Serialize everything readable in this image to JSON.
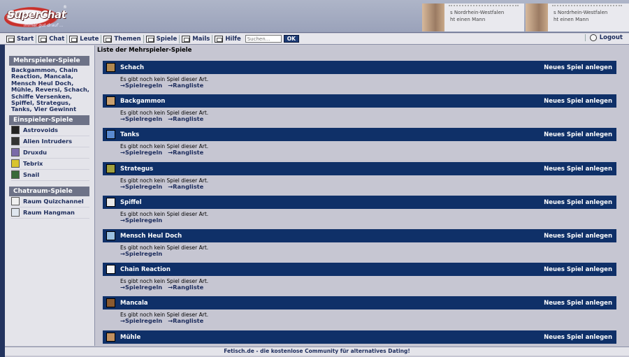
{
  "logo": {
    "name": "SuperChat",
    "tagline": "immer gut drauf ...",
    "reg": "®"
  },
  "ads": [
    {
      "line1": "s Nordrhein-Westfalen",
      "line2": "ht einen Mann"
    },
    {
      "line1": "s Nordrhein-Westfalen",
      "line2": "ht einen Mann"
    }
  ],
  "nav": {
    "items": [
      {
        "label": "Start",
        "icon": "home-icon"
      },
      {
        "label": "Chat",
        "icon": "chat-icon"
      },
      {
        "label": "Leute",
        "icon": "people-icon"
      },
      {
        "label": "Themen",
        "icon": "topics-icon"
      },
      {
        "label": "Spiele",
        "icon": "games-icon"
      },
      {
        "label": "Mails",
        "icon": "mail-icon"
      },
      {
        "label": "Hilfe",
        "icon": "help-icon"
      }
    ],
    "search_placeholder": "Suchen...",
    "ok_label": "OK",
    "logout_label": "Logout"
  },
  "sidebar": {
    "multi_title": "Mehrspieler-Spiele",
    "multi_list": "Backgammon, Chain Reaction, Mancala, Mensch Heul Doch, Mühle, Reversi, Schach, Schiffe Versenken, Spiffel, Strategus, Tanks, Vier Gewinnt",
    "single_title": "Einspieler-Spiele",
    "single_items": [
      {
        "label": "Astrovoids",
        "color": "#222222"
      },
      {
        "label": "Alien Intruders",
        "color": "#333333"
      },
      {
        "label": "Druxdu",
        "color": "#7a6aa8"
      },
      {
        "label": "Tebrix",
        "color": "#d8c430"
      },
      {
        "label": "Snail",
        "color": "#3a6a3a"
      }
    ],
    "chat_title": "Chatraum-Spiele",
    "chat_items": [
      {
        "label": "Raum Quizchannel",
        "color": "#f0f0f0"
      },
      {
        "label": "Raum Hangman",
        "color": "#dfe6ef"
      }
    ]
  },
  "main": {
    "title": "Liste der Mehrspieler-Spiele",
    "new_game_label": "Neues Spiel anlegen",
    "no_game_text": "Es gibt noch kein Spiel dieser Art.",
    "rules_label": "Spielregeln",
    "ranking_label": "Rangliste",
    "games": [
      {
        "name": "Schach",
        "has_ranking": true,
        "color": "#b08850"
      },
      {
        "name": "Backgammon",
        "has_ranking": true,
        "color": "#c8a070"
      },
      {
        "name": "Tanks",
        "has_ranking": true,
        "color": "#5a8ad0"
      },
      {
        "name": "Strategus",
        "has_ranking": true,
        "color": "#a0a040"
      },
      {
        "name": "Spiffel",
        "has_ranking": false,
        "color": "#e8e8e8"
      },
      {
        "name": "Mensch Heul Doch",
        "has_ranking": false,
        "color": "#9ac0e0"
      },
      {
        "name": "Chain Reaction",
        "has_ranking": true,
        "color": "#f4f4f4"
      },
      {
        "name": "Mancala",
        "has_ranking": true,
        "color": "#8a5a30"
      },
      {
        "name": "Mühle",
        "has_ranking": null,
        "color": "#c09060"
      }
    ]
  },
  "footer": {
    "text": "Fetisch.de - die kostenlose Community für alternatives Dating!"
  }
}
